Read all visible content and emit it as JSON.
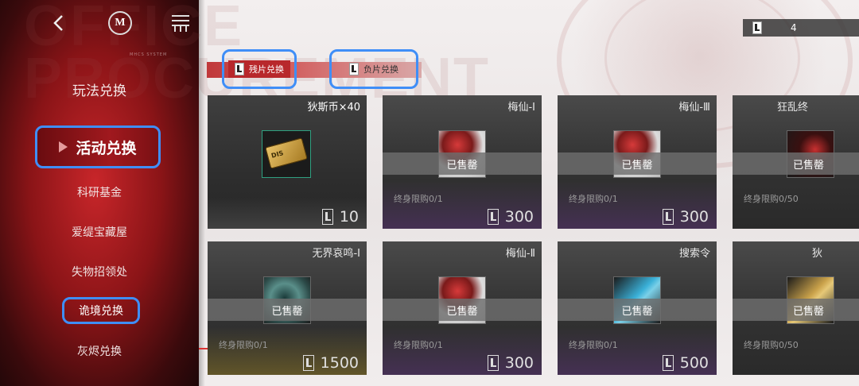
{
  "sidebar": {
    "watermark_text": "MHCS SYSTEM",
    "section_title": "玩法兑换",
    "active_item": "活动兑换",
    "items": [
      {
        "label": "科研基金"
      },
      {
        "label": "爱缇宝藏屋"
      },
      {
        "label": "失物招领处"
      },
      {
        "label": "诡境兑换"
      },
      {
        "label": "灰烬兑换"
      }
    ]
  },
  "background_text": {
    "line1": "OFFICE",
    "line2": "PROCUREMENT"
  },
  "currency": {
    "icon": "film-token-icon",
    "value": "4"
  },
  "tabs": [
    {
      "label": "残片兑换",
      "icon": "film-token-icon",
      "active": true
    },
    {
      "label": "负片兑换",
      "icon": "film-token-icon",
      "active": false
    }
  ],
  "cards": [
    {
      "name": "狄斯币×40",
      "sold": "",
      "limit": "",
      "price": "10",
      "thumb": "coin-icon",
      "featured": true
    },
    {
      "name": "梅仙-Ⅰ",
      "sold": "已售罄",
      "limit": "终身限购0/1",
      "price": "300",
      "thumb": "red-flower-icon"
    },
    {
      "name": "梅仙-Ⅲ",
      "sold": "已售罄",
      "limit": "终身限购0/1",
      "price": "300",
      "thumb": "red-flower-icon"
    },
    {
      "name": "狂乱终",
      "sold": "已售罄",
      "limit": "终身限购0/50",
      "price": "",
      "thumb": "dark-red-icon"
    },
    {
      "name": "无界哀鸣-Ⅰ",
      "sold": "已售罄",
      "limit": "终身限购0/1",
      "price": "1500",
      "thumb": "teal-swirl-icon"
    },
    {
      "name": "梅仙-Ⅱ",
      "sold": "已售罄",
      "limit": "终身限购0/1",
      "price": "300",
      "thumb": "red-flower-icon"
    },
    {
      "name": "搜索令",
      "sold": "已售罄",
      "limit": "终身限购0/1",
      "price": "500",
      "thumb": "blue-badge-icon"
    },
    {
      "name": "狄",
      "sold": "已售罄",
      "limit": "终身限购0/50",
      "price": "",
      "thumb": "gold-item-icon"
    }
  ]
}
